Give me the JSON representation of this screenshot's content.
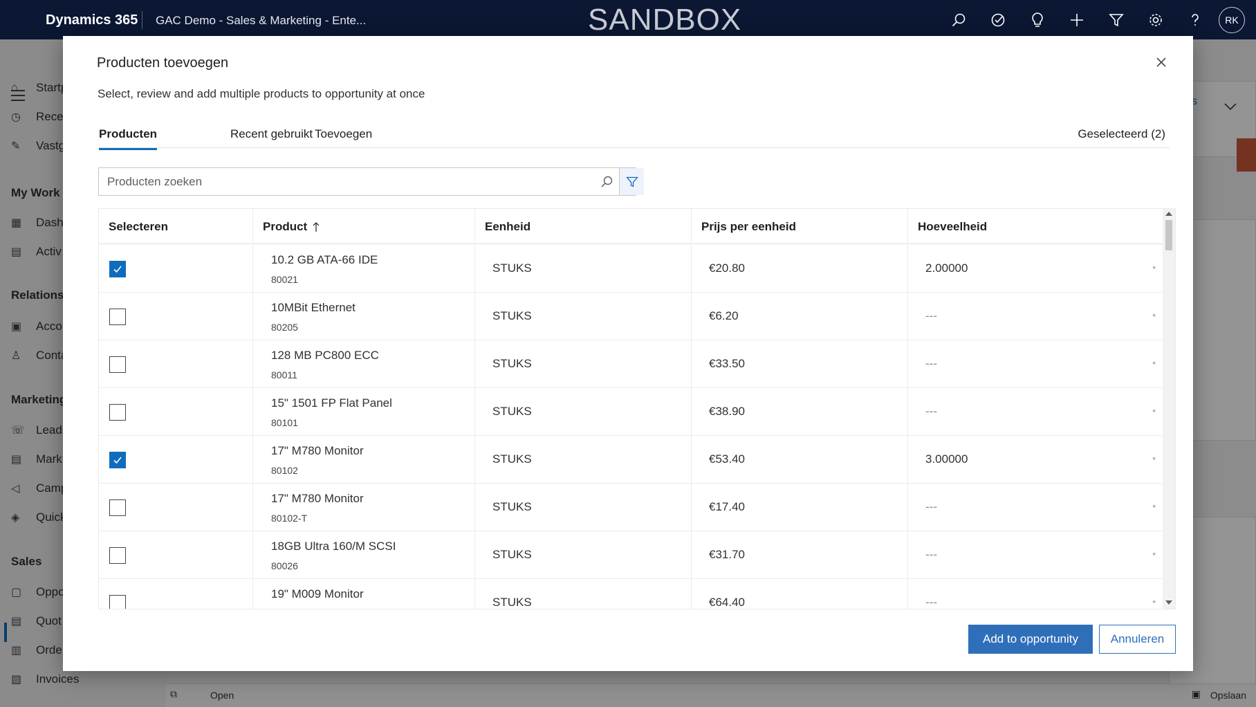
{
  "topbar": {
    "brand": "Dynamics 365",
    "app_name": "GAC Demo - Sales & Marketing - Ente...",
    "environment_label": "SANDBOX",
    "avatar_initials": "RK"
  },
  "nav": {
    "items_top": [
      "Startp",
      "Recen",
      "Vastg"
    ],
    "group_my_work": "My Work",
    "items_my_work": [
      "Dash",
      "Activ"
    ],
    "group_relationships": "Relationsh",
    "items_relationships": [
      "Acco",
      "Conta"
    ],
    "group_marketing": "Marketing",
    "items_marketing": [
      "Leads",
      "Mark",
      "Camp",
      "Quick"
    ],
    "group_sales": "Sales",
    "items_sales": [
      "Oppo",
      "Quot",
      "Orde",
      "Invoices"
    ]
  },
  "background": {
    "bottom_open": "Open",
    "bottom_save": "Opslaan",
    "link_fragment": "s"
  },
  "dialog": {
    "title": "Producten toevoegen",
    "subtitle": "Select, review and add multiple products to opportunity at once",
    "tabs": [
      "Producten",
      "Recent gebruikt",
      "Toevoegen"
    ],
    "selected_count": "Geselecteerd (2)",
    "search_placeholder": "Producten zoeken",
    "columns": [
      "Selecteren",
      "Product",
      "Eenheid",
      "Prijs per eenheid",
      "Hoeveelheid"
    ],
    "rows": [
      {
        "selected": true,
        "name": "10.2 GB ATA-66 IDE",
        "code": "80021",
        "unit": "STUKS",
        "price": "€20.80",
        "quantity": "2.00000"
      },
      {
        "selected": false,
        "name": "10MBit Ethernet",
        "code": "80205",
        "unit": "STUKS",
        "price": "€6.20",
        "quantity": "---"
      },
      {
        "selected": false,
        "name": "128 MB PC800 ECC",
        "code": "80011",
        "unit": "STUKS",
        "price": "€33.50",
        "quantity": "---"
      },
      {
        "selected": false,
        "name": "15\" 1501 FP Flat Panel",
        "code": "80101",
        "unit": "STUKS",
        "price": "€38.90",
        "quantity": "---"
      },
      {
        "selected": true,
        "name": "17\" M780 Monitor",
        "code": "80102",
        "unit": "STUKS",
        "price": "€53.40",
        "quantity": "3.00000"
      },
      {
        "selected": false,
        "name": "17\" M780 Monitor",
        "code": "80102-T",
        "unit": "STUKS",
        "price": "€17.40",
        "quantity": "---"
      },
      {
        "selected": false,
        "name": "18GB Ultra 160/M SCSI",
        "code": "80026",
        "unit": "STUKS",
        "price": "€31.70",
        "quantity": "---"
      },
      {
        "selected": false,
        "name": "19\" M009 Monitor",
        "code": "",
        "unit": "STUKS",
        "price": "€64.40",
        "quantity": "---"
      }
    ],
    "required_marker": "*",
    "primary_button": "Add to opportunity",
    "cancel_button": "Annuleren"
  },
  "colors": {
    "accent": "#0f6cbd",
    "primary_button": "#2f6fba",
    "topbar": "#0b1733"
  }
}
